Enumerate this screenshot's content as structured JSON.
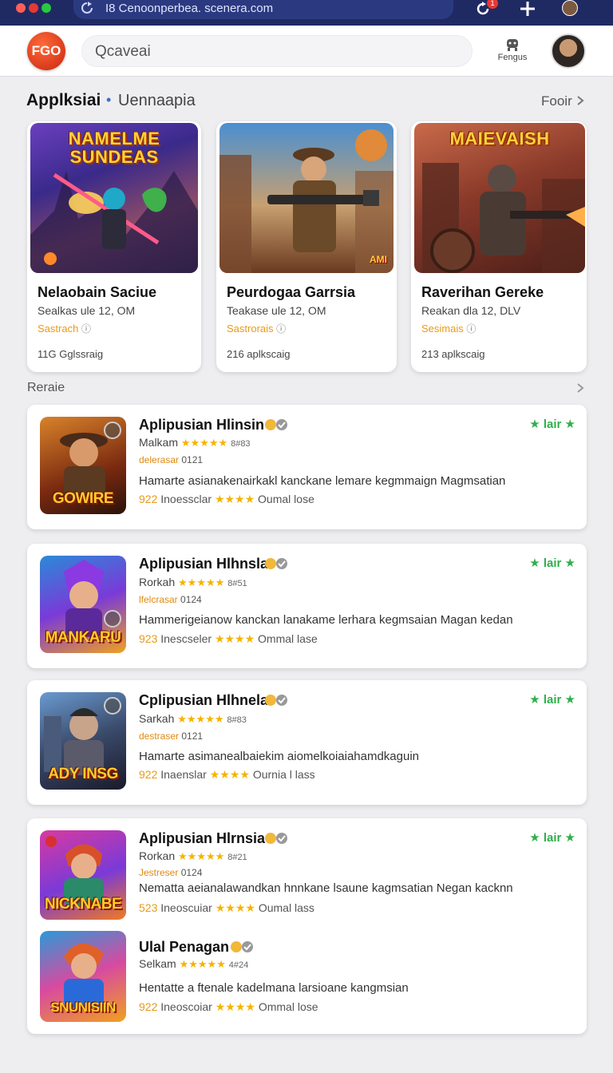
{
  "browser": {
    "url": "I8 Cenoonperbea. scenera.com",
    "notif_count": "1",
    "colors": {
      "red": "#ff5f57",
      "yellow": "#e53935",
      "green": "#28c840"
    }
  },
  "header": {
    "logo": "FGO",
    "search_placeholder": "Qcaveai",
    "action_label": "Fengus"
  },
  "section": {
    "title": "Applksiai",
    "separator": "•",
    "subtitle": "Uennaapia",
    "more": "Fooir"
  },
  "featured": [
    {
      "art_title": "NAMELME SUNDEAS",
      "title": "Nelaobain Saciue",
      "sub": "Sealkas ule 12, OM",
      "tag": "Sastrach",
      "count": "11G Gglssraig",
      "art_badge": ""
    },
    {
      "art_title": "",
      "title": "Peurdogaa Garrsia",
      "sub": "Teakase ule 12, OM",
      "tag": "Sastrorais",
      "count": "216 aplkscaig",
      "art_badge": "AMI"
    },
    {
      "art_title": "MAIEVAISH",
      "title": "Raverihan Gereke",
      "sub": "Reakan dla 12, DLV",
      "tag": "Sesimais",
      "count": "213 aplkscaig",
      "art_badge": ""
    }
  ],
  "list_header": "Reraie",
  "list": [
    {
      "icon_text": "GOWIRE",
      "title": "Aplipusian Hlinsin",
      "meta_left": "Malkam",
      "meta_stars": "★★★★★",
      "meta_count": "8#83",
      "tag_left": "delerasar",
      "tag_right": "0121",
      "desc": "Hamarte asianakenairkakl kanckane lemare kegmmaign Magmsatian",
      "foot_num": "922",
      "foot_label": "Inoessclar",
      "foot_stars": "★★★★",
      "foot_right": "Oumal lose",
      "rating": "★ lair ★"
    },
    {
      "icon_text": "MANKARU",
      "title": "Aplipusian Hlhnsla",
      "meta_left": "Rorkah",
      "meta_stars": "★★★★★",
      "meta_count": "8#51",
      "tag_left": "lfelcrasar",
      "tag_right": "0124",
      "desc": "Hammerigeianow kanckan lanakame lerhara kegmsaian Magan kedan",
      "foot_num": "923",
      "foot_label": "Inescseler",
      "foot_stars": "★★★★",
      "foot_right": "Ommal lase",
      "rating": "★ lair ★"
    },
    {
      "icon_text": "ADY INSG",
      "title": "Cplipusian Hlhnela",
      "meta_left": "Sarkah",
      "meta_stars": "★★★★★",
      "meta_count": "8#83",
      "tag_left": "destraser",
      "tag_right": "0121",
      "desc": "Hamarte asimanealbaiekim aiomelkoiaiahamdkaguin",
      "foot_num": "922",
      "foot_label": "Inaenslar",
      "foot_stars": "★★★★",
      "foot_right": "Ournia l lass",
      "rating": "★ lair ★"
    },
    {
      "icon_text": "NICKNABE",
      "title": "Aplipusian Hlrnsia",
      "meta_left": "Rorkan",
      "meta_stars": "★★★★★",
      "meta_count": "8#21",
      "tag_left": "Jestreser",
      "tag_right": "0124",
      "desc": "Nematta aeianalawandkan hnnkane lsaune kagmsatian Negan kacknn",
      "foot_num": "523",
      "foot_label": "Ineoscuiar",
      "foot_stars": "★★★★",
      "foot_right": "Oumal lass",
      "rating": "★ lair ★"
    },
    {
      "icon_text": "SNUNISIIN",
      "title": "Ulal Penagan",
      "meta_left": "Selkam",
      "meta_stars": "★★★★★",
      "meta_count": "4#24",
      "tag_left": "",
      "tag_right": "",
      "desc": "Hentatte a ftenale kadelmana larsioane kangmsian",
      "foot_num": "922",
      "foot_label": "Ineoscoiar",
      "foot_stars": "★★★★",
      "foot_right": "Ommal lose",
      "rating": ""
    }
  ]
}
